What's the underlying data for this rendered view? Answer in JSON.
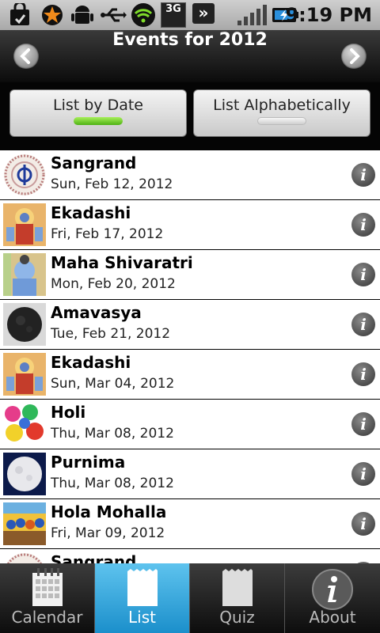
{
  "status_bar": {
    "time": "9:19 PM",
    "network": "3G",
    "icons": [
      "shopping-bag-icon",
      "star-icon",
      "android-icon",
      "usb-icon",
      "wifi-icon",
      "3g-icon",
      "fast-forward-icon",
      "signal-icon",
      "battery-charging-icon"
    ]
  },
  "header": {
    "title": "Events for 2012",
    "prev_icon": "chevron-left-icon",
    "next_icon": "chevron-right-icon"
  },
  "segments": {
    "by_date": "List by Date",
    "alphabetical": "List Alphabetically",
    "selected": "by_date"
  },
  "events": [
    {
      "name": "Sangrand",
      "date": "Sun, Feb 12, 2012",
      "thumb": "khanda-icon"
    },
    {
      "name": "Ekadashi",
      "date": "Fri, Feb 17, 2012",
      "thumb": "deity-image"
    },
    {
      "name": "Maha Shivaratri",
      "date": "Mon, Feb 20, 2012",
      "thumb": "shiva-image"
    },
    {
      "name": "Amavasya",
      "date": "Tue, Feb 21, 2012",
      "thumb": "new-moon-image"
    },
    {
      "name": "Ekadashi",
      "date": "Sun, Mar 04, 2012",
      "thumb": "deity-image"
    },
    {
      "name": "Holi",
      "date": "Thu, Mar 08, 2012",
      "thumb": "holi-colors-image"
    },
    {
      "name": "Purnima",
      "date": "Thu, Mar 08, 2012",
      "thumb": "full-moon-image"
    },
    {
      "name": "Hola Mohalla",
      "date": "Fri, Mar 09, 2012",
      "thumb": "hola-mohalla-image"
    },
    {
      "name": "Sangrand",
      "date": "",
      "thumb": "khanda-icon"
    }
  ],
  "tabs": [
    {
      "label": "Calendar",
      "icon": "calendar-icon"
    },
    {
      "label": "List",
      "icon": "list-icon",
      "active": true
    },
    {
      "label": "Quiz",
      "icon": "quiz-icon"
    },
    {
      "label": "About",
      "icon": "info-icon"
    }
  ],
  "colors": {
    "tab_active": "#2ea8e0",
    "seg_indicator_active": "#6bd21e"
  }
}
